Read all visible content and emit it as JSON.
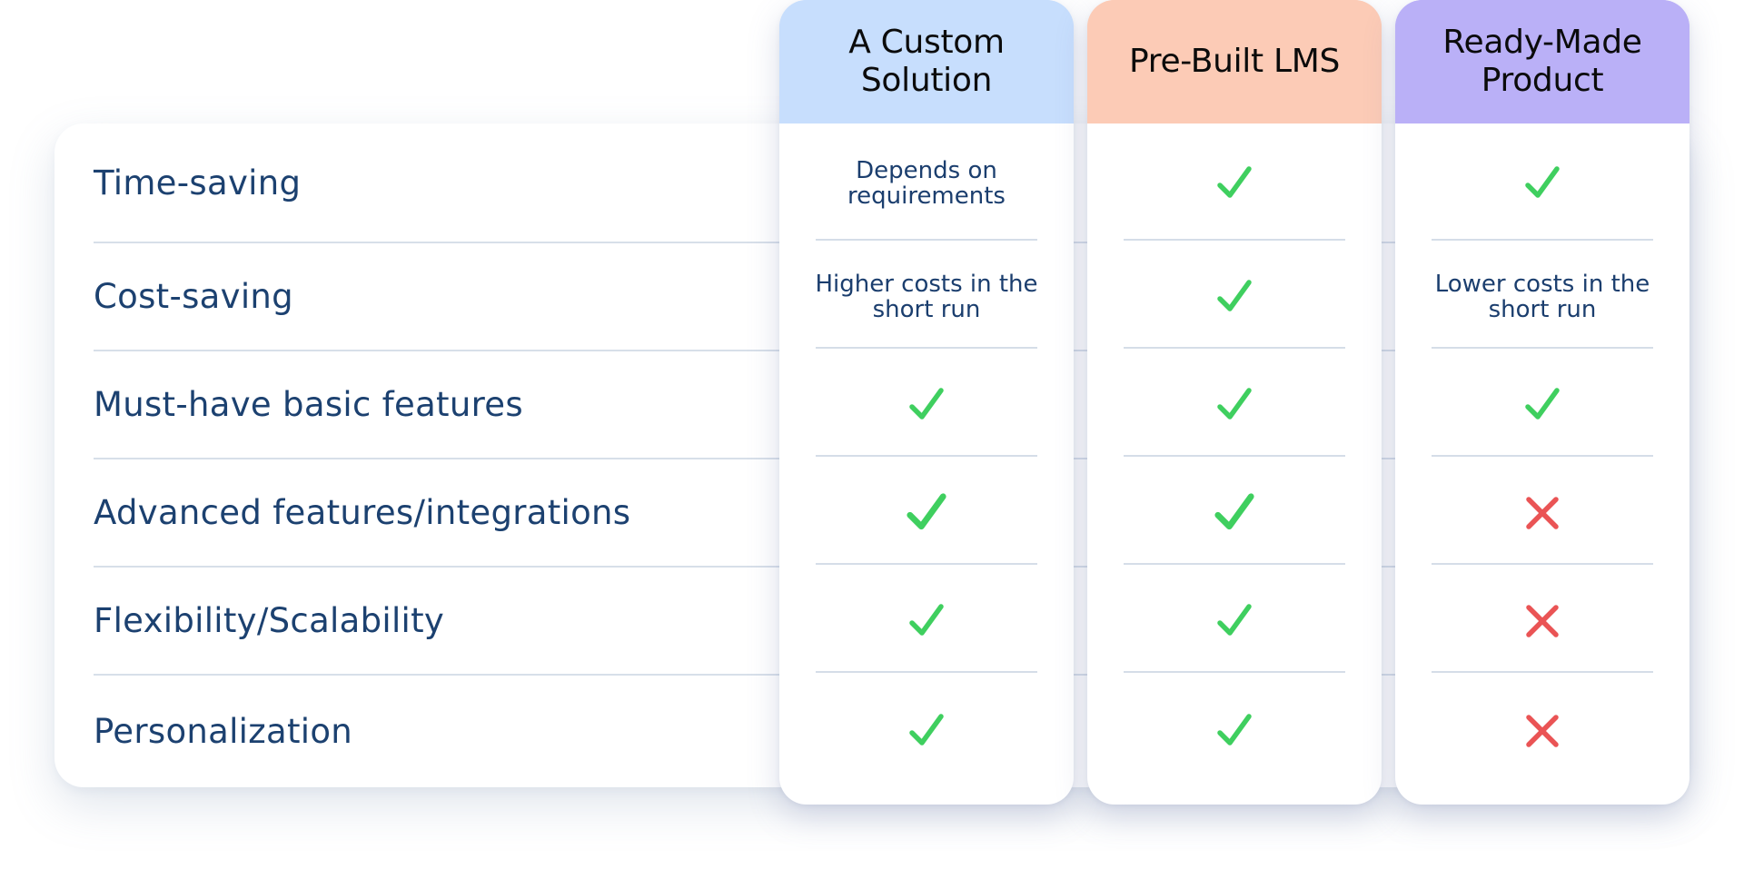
{
  "table": {
    "columns": [
      {
        "title": "A Custom Solution",
        "header_color": "#c7defd",
        "cells": [
          {
            "type": "text",
            "text": "Depends on requirements"
          },
          {
            "type": "text",
            "text": "Higher costs in the short run"
          },
          {
            "type": "check"
          },
          {
            "type": "check"
          },
          {
            "type": "check"
          },
          {
            "type": "check"
          }
        ]
      },
      {
        "title": "Pre-Built LMS",
        "header_color": "#fccbb6",
        "cells": [
          {
            "type": "check"
          },
          {
            "type": "check"
          },
          {
            "type": "check"
          },
          {
            "type": "check"
          },
          {
            "type": "check"
          },
          {
            "type": "check"
          }
        ]
      },
      {
        "title": "Ready-Made Product",
        "header_color": "#bab0f7",
        "cells": [
          {
            "type": "check"
          },
          {
            "type": "text",
            "text": "Lower costs in the short run"
          },
          {
            "type": "check"
          },
          {
            "type": "cross"
          },
          {
            "type": "cross"
          },
          {
            "type": "cross"
          }
        ]
      }
    ],
    "rows": [
      {
        "label": "Time-saving"
      },
      {
        "label": "Cost-saving"
      },
      {
        "label": "Must-have basic features"
      },
      {
        "label": "Advanced features/integrations"
      },
      {
        "label": "Flexibility/Scalability"
      },
      {
        "label": "Personalization"
      }
    ]
  },
  "icons": {
    "check": "check-icon",
    "cross": "cross-icon"
  },
  "colors": {
    "check": "#3fcf5f",
    "cross": "#ea5455",
    "label_text": "#1c4170",
    "cell_text": "#1b3e6e"
  }
}
